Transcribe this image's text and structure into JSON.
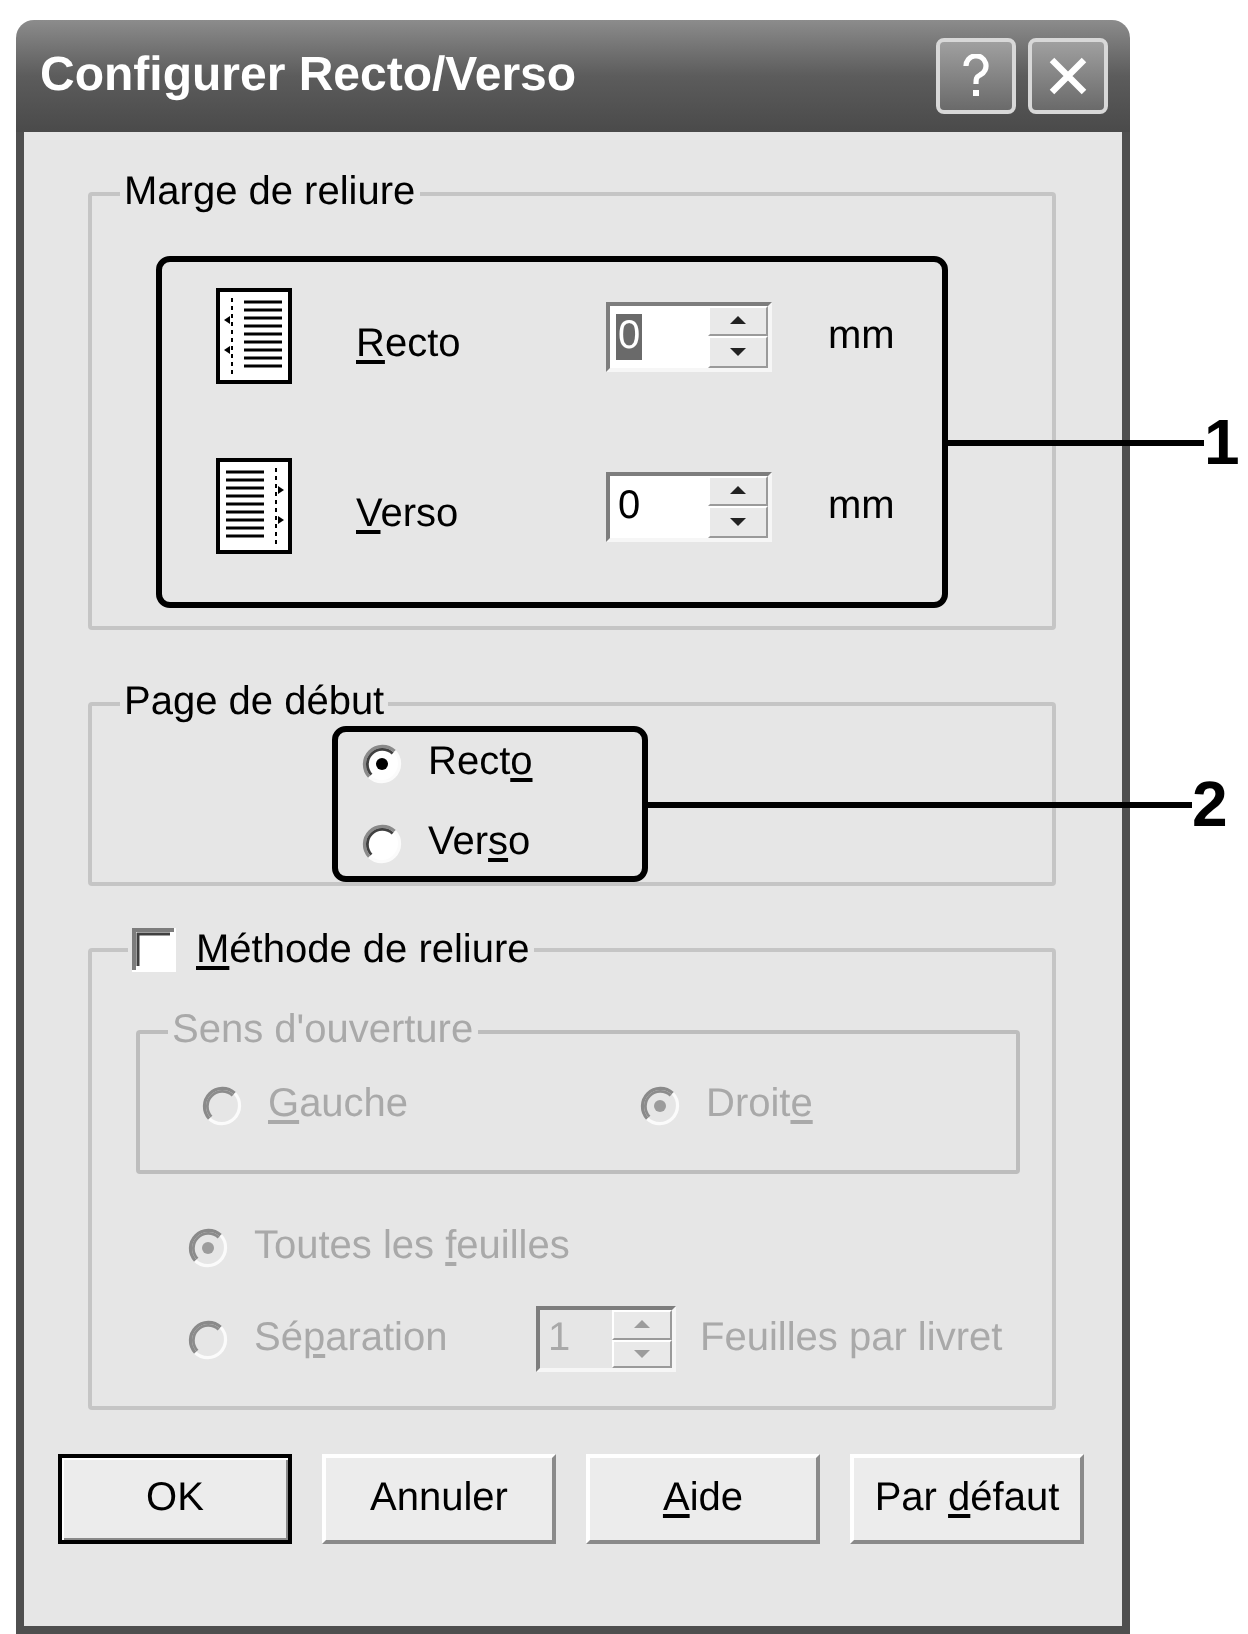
{
  "window": {
    "title": "Configurer Recto/Verso"
  },
  "binding_margin": {
    "label": "Marge de reliure",
    "callout": "1",
    "rows": [
      {
        "label": "Recto",
        "value": "0",
        "unit": "mm",
        "focused": true
      },
      {
        "label": "Verso",
        "value": "0",
        "unit": "mm",
        "focused": false
      }
    ]
  },
  "start_page": {
    "label": "Page de début",
    "callout": "2",
    "options": [
      {
        "label": "Recto",
        "selected": true,
        "disabled": false
      },
      {
        "label": "Verso",
        "selected": false,
        "disabled": false
      }
    ]
  },
  "binding_method": {
    "label": "Méthode de reliure",
    "checked": false,
    "opening_direction": {
      "label": "Sens d'ouverture",
      "disabled": true,
      "options": [
        {
          "label": "Gauche",
          "selected": false,
          "disabled": true
        },
        {
          "label": "Droite",
          "selected": true,
          "disabled": true
        }
      ]
    },
    "sheets": [
      {
        "label": "Toutes les feuilles",
        "selected": true,
        "disabled": true
      },
      {
        "label": "Séparation",
        "selected": false,
        "disabled": true
      }
    ],
    "sheets_per_booklet": {
      "value": "1",
      "label": "Feuilles par livret",
      "disabled": true
    }
  },
  "buttons": [
    {
      "label": "OK",
      "default": true
    },
    {
      "label": "Annuler",
      "default": false
    },
    {
      "label": "Aide",
      "default": false
    },
    {
      "label": "Par défaut",
      "default": false
    }
  ]
}
